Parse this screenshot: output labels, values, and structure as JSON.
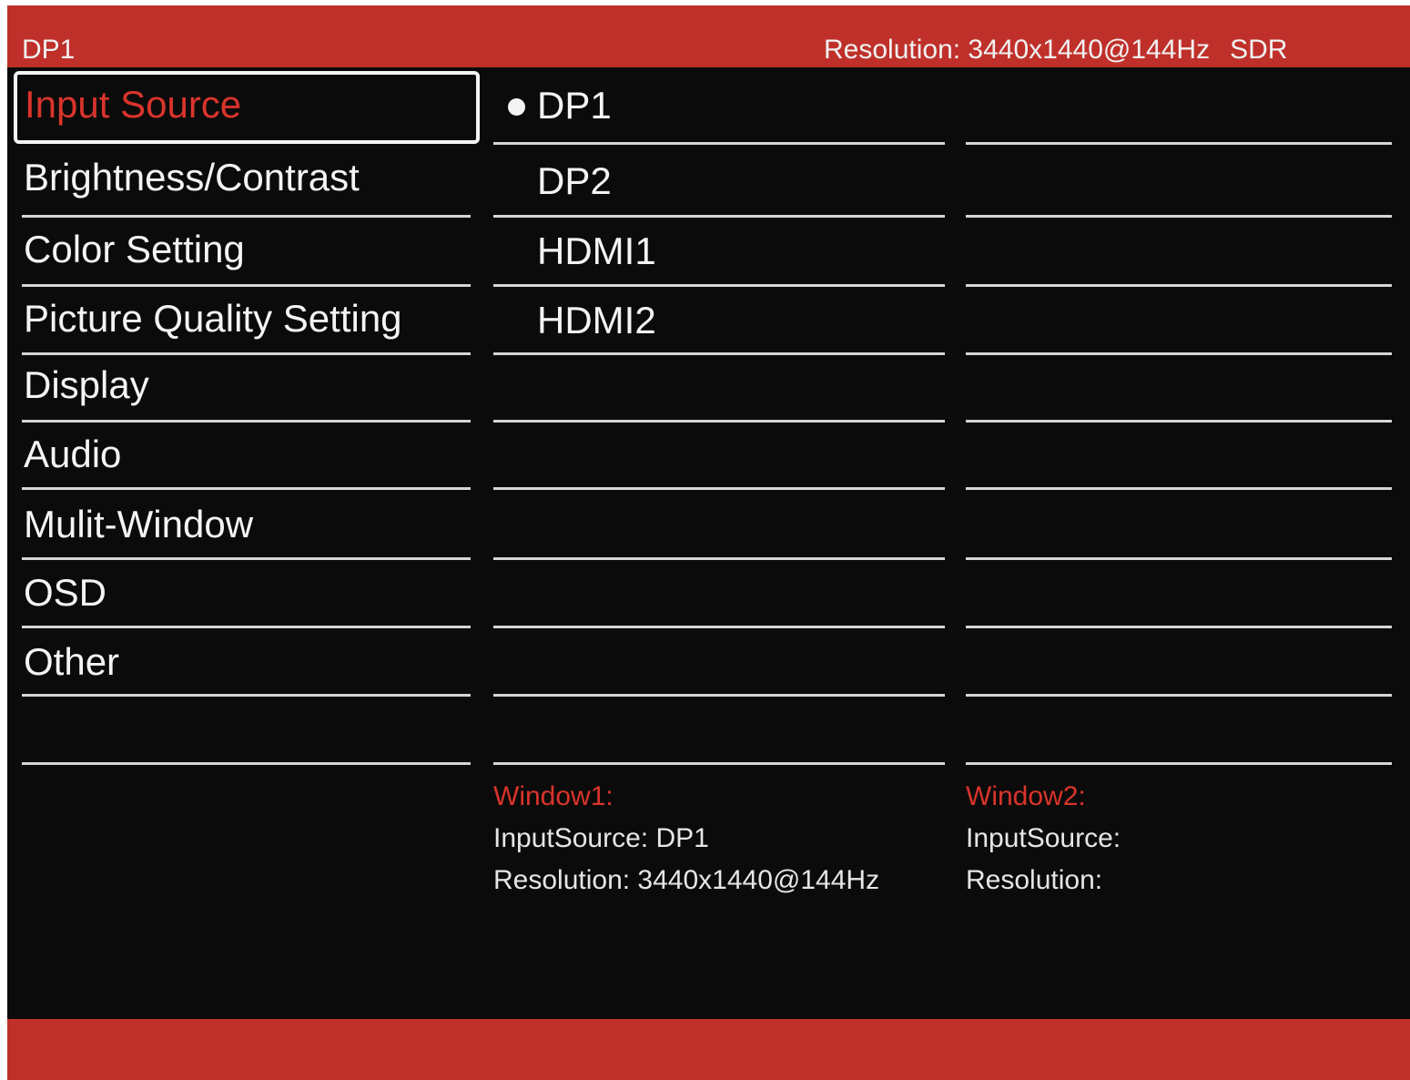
{
  "header": {
    "current_source": "DP1",
    "resolution_text": "Resolution: 3440x1440@144Hz",
    "dynamic_range": "SDR"
  },
  "menu": {
    "items": [
      {
        "label": "Input Source",
        "selected": true
      },
      {
        "label": "Brightness/Contrast"
      },
      {
        "label": "Color Setting"
      },
      {
        "label": "Picture Quality Setting"
      },
      {
        "label": "Display"
      },
      {
        "label": "Audio"
      },
      {
        "label": "Mulit-Window"
      },
      {
        "label": "OSD"
      },
      {
        "label": "Other"
      }
    ]
  },
  "options": {
    "items": [
      {
        "label": "DP1",
        "active": true
      },
      {
        "label": "DP2"
      },
      {
        "label": "HDMI1"
      },
      {
        "label": "HDMI2"
      }
    ]
  },
  "windows": [
    {
      "title": "Window1:",
      "input_source": "InputSource: DP1",
      "resolution": "Resolution: 3440x1440@144Hz"
    },
    {
      "title": "Window2:",
      "input_source": "InputSource:",
      "resolution": "Resolution:"
    }
  ],
  "colors": {
    "accent": "#c0302a",
    "highlight_text": "#d9342b",
    "background": "#0b0b0b",
    "text": "#f4f4f4"
  }
}
